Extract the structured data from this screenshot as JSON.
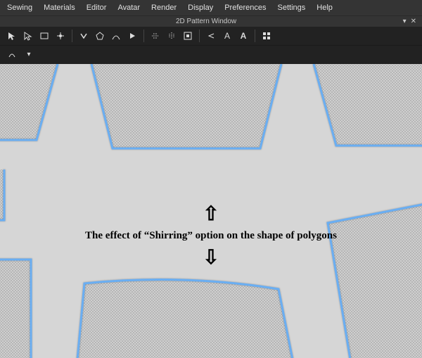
{
  "menubar": {
    "items": [
      "Sewing",
      "Materials",
      "Editor",
      "Avatar",
      "Render",
      "Display",
      "Preferences",
      "Settings",
      "Help"
    ]
  },
  "window": {
    "title": "2D Pattern Window"
  },
  "toolbar_icons": [
    "pointer-icon",
    "direct-select-icon",
    "rectangle-icon",
    "add-point-icon",
    "chevron-icon",
    "polygon-icon",
    "curve-icon",
    "play-icon",
    "align-h-icon",
    "align-v-icon",
    "fit-icon",
    "arrow-left-icon",
    "text-a-icon",
    "text-a-bold-icon",
    "grid-icon"
  ],
  "toolbar2_icons": [
    "tool-a-icon",
    "tool-b-icon"
  ],
  "annotation": {
    "text": "The effect of “Shirring” option on the shape of polygons"
  },
  "colors": {
    "pattern_outline": "#6aaef2",
    "viewport_bg": "#d6d6d6",
    "ui_bg": "#222222"
  }
}
